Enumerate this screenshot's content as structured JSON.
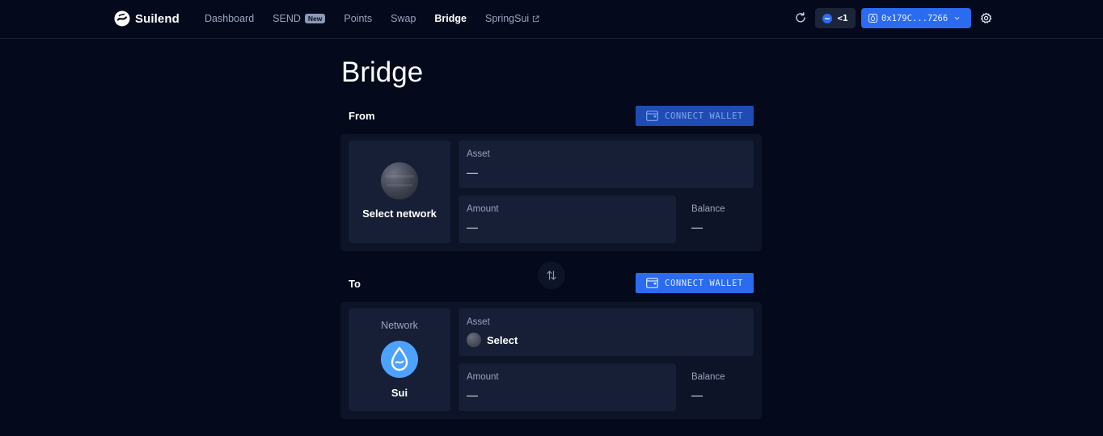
{
  "header": {
    "brand": "Suilend",
    "nav": [
      {
        "label": "Dashboard"
      },
      {
        "label": "SEND",
        "badge": "New"
      },
      {
        "label": "Points"
      },
      {
        "label": "Swap"
      },
      {
        "label": "Bridge",
        "active": true
      },
      {
        "label": "SpringSui",
        "external": true
      }
    ],
    "points_value": "<1",
    "wallet_address": "0x179C...7266"
  },
  "page": {
    "title": "Bridge",
    "from": {
      "label": "From",
      "connect_label": "CONNECT WALLET",
      "network_label": "Select network",
      "asset_label": "Asset",
      "asset_value": "—",
      "amount_label": "Amount",
      "amount_value": "—",
      "balance_label": "Balance",
      "balance_value": "—"
    },
    "to": {
      "label": "To",
      "connect_label": "CONNECT WALLET",
      "network_caption": "Network",
      "network_name": "Sui",
      "asset_label": "Asset",
      "asset_select": "Select",
      "amount_label": "Amount",
      "amount_value": "—",
      "balance_label": "Balance",
      "balance_value": "—"
    }
  },
  "colors": {
    "background": "#040a1c",
    "card": "#0d1428",
    "field": "#161f36",
    "accent": "#2a6bf0",
    "accent_dim": "#1f4bb4",
    "muted_text": "#9aa4bd",
    "sui_blue": "#4da2ff"
  }
}
